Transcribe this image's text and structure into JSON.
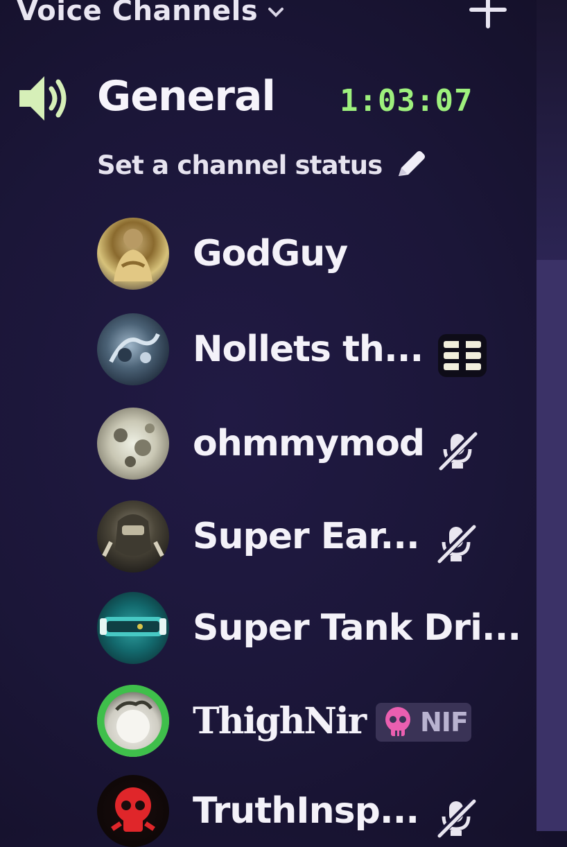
{
  "header": {
    "label": "Voice Channels"
  },
  "channel": {
    "name": "General",
    "timer": "1:03:07",
    "status_prompt": "Set a channel status"
  },
  "users": [
    {
      "name": "GodGuy",
      "status_icon": ""
    },
    {
      "name": "Nollets th...",
      "status_icon": "stream-icon"
    },
    {
      "name": "ohmmymod",
      "status_icon": "muted-mic-icon"
    },
    {
      "name": "Super Ear...",
      "status_icon": "muted-mic-icon"
    },
    {
      "name": "Super Tank Dri...",
      "status_icon": ""
    },
    {
      "name": "ThighNir",
      "status_icon": "",
      "tag": "NIF"
    },
    {
      "name": "TruthInsp...",
      "status_icon": "muted-mic-icon"
    }
  ],
  "colors": {
    "background": "#1b1638",
    "timer": "#9ef07d",
    "speaking_ring": "#3fbf4b"
  }
}
